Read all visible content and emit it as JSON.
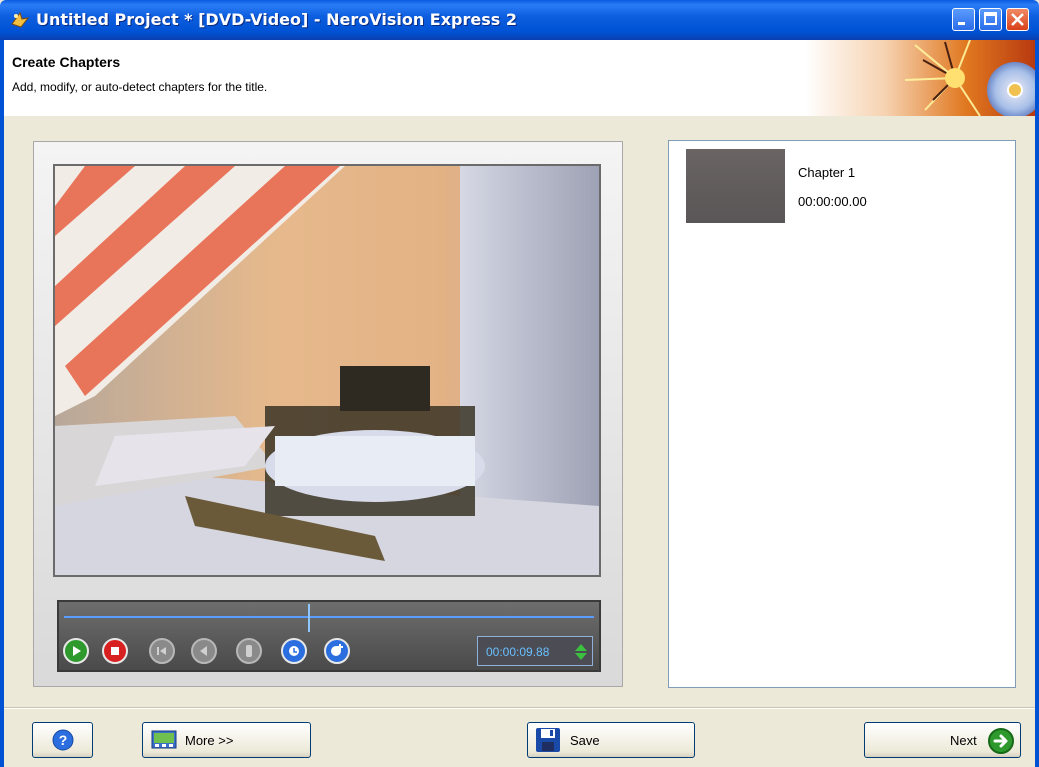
{
  "window": {
    "title": "Untitled Project * [DVD-Video] - NeroVision Express 2"
  },
  "header": {
    "title": "Create Chapters",
    "subtitle": "Add, modify, or auto-detect chapters for the title."
  },
  "player": {
    "time": "00:00:09.88",
    "position_fraction": 0.46,
    "controls": [
      "play-icon",
      "stop-icon",
      "previous-chapter-icon",
      "rewind-icon",
      "chapter-marker-icon",
      "auto-detect-icon",
      "add-chapter-icon"
    ]
  },
  "chapters": [
    {
      "name": "Chapter 1",
      "time": "00:00:00.00"
    }
  ],
  "footer": {
    "more_label": "More >>",
    "save_label": "Save",
    "next_label": "Next"
  }
}
